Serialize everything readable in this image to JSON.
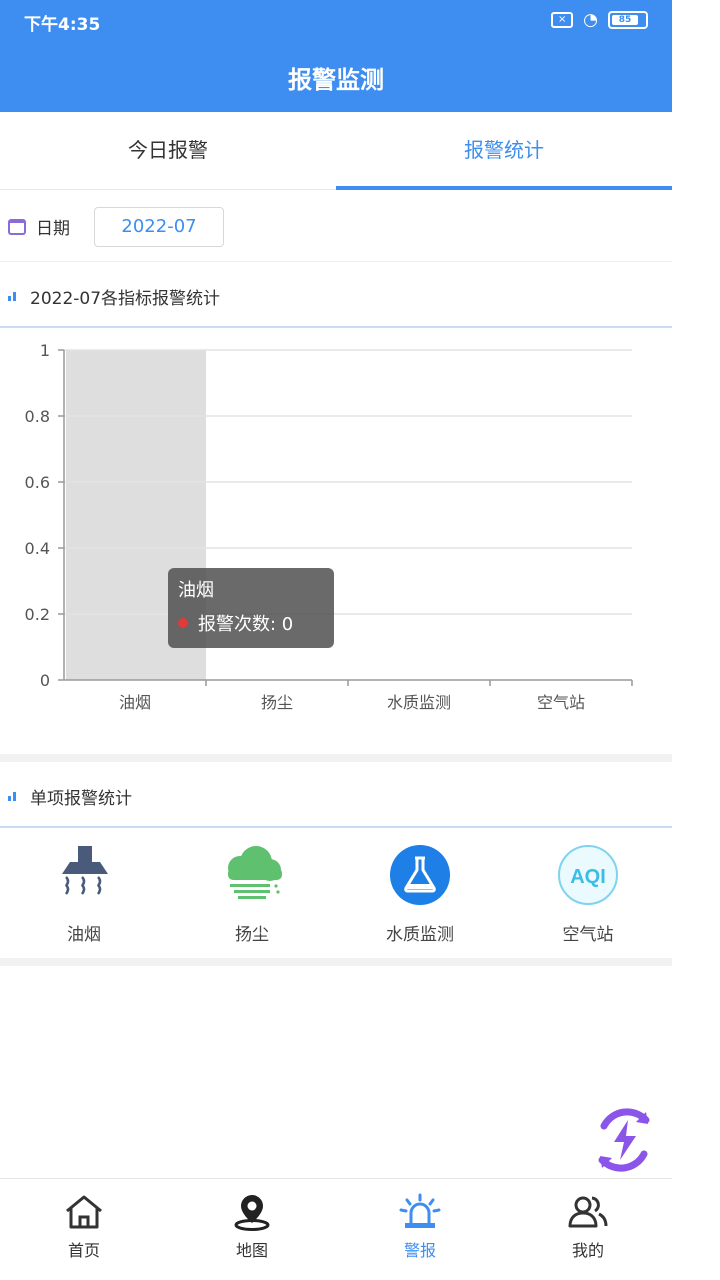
{
  "status_bar": {
    "time": "下午4:35",
    "battery": "85"
  },
  "header": {
    "title": "报警监测"
  },
  "tabs": [
    {
      "label": "今日报警",
      "active": false
    },
    {
      "label": "报警统计",
      "active": true
    }
  ],
  "date_filter": {
    "label": "日期",
    "value": "2022-07"
  },
  "chart_section": {
    "title": "2022-07各指标报警统计"
  },
  "chart_data": {
    "type": "bar",
    "categories": [
      "油烟",
      "扬尘",
      "水质监测",
      "空气站"
    ],
    "series": [
      {
        "name": "报警次数",
        "values": [
          0,
          0,
          0,
          0
        ]
      }
    ],
    "ylim": [
      0,
      1
    ],
    "yticks": [
      "0",
      "0.2",
      "0.4",
      "0.6",
      "0.8",
      "1"
    ],
    "grid": true,
    "highlighted_category": "油烟"
  },
  "tooltip": {
    "title": "油烟",
    "series_label": "报警次数: 0",
    "dot_color": "#e03a3a"
  },
  "single_section": {
    "title": "单项报警统计"
  },
  "single_items": [
    {
      "label": "油烟",
      "icon": "range-hood-icon"
    },
    {
      "label": "扬尘",
      "icon": "dust-cloud-icon"
    },
    {
      "label": "水质监测",
      "icon": "flask-icon"
    },
    {
      "label": "空气站",
      "icon": "aqi-icon",
      "icon_text": "AQI"
    }
  ],
  "bottom_nav": [
    {
      "label": "首页",
      "icon": "home-icon",
      "active": false
    },
    {
      "label": "地图",
      "icon": "map-pin-icon",
      "active": false
    },
    {
      "label": "警报",
      "icon": "alarm-light-icon",
      "active": true
    },
    {
      "label": "我的",
      "icon": "users-icon",
      "active": false
    }
  ],
  "colors": {
    "primary": "#3d8ef0",
    "purple": "#8a55e8"
  }
}
